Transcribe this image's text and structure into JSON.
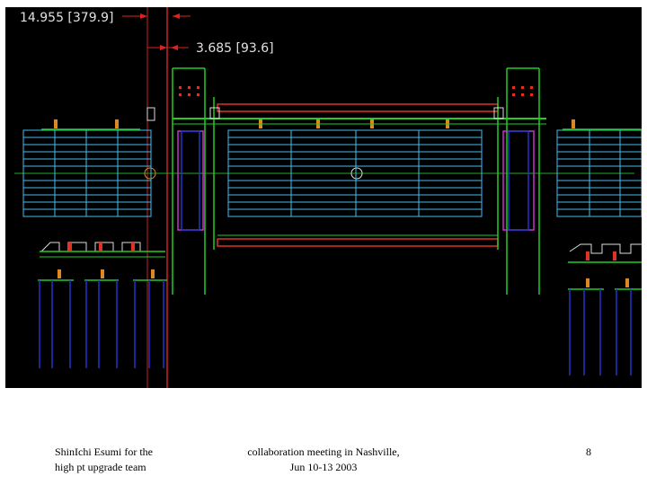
{
  "drawing": {
    "dim_outer": "14.955 [379.9]",
    "dim_inner": "3.685 [93.6]"
  },
  "footer": {
    "author_line1": "ShinIchi Esumi for the",
    "author_line2": "high pt upgrade team",
    "meeting_line1": "collaboration meeting in Nashville,",
    "meeting_line2": "Jun 10-13 2003",
    "page_number": "8"
  },
  "colors": {
    "background": "#000000",
    "frame_green": "#22cc22",
    "ladder_cyan": "#44bbee",
    "beam_red": "#dd3322",
    "support_blue": "#2233cc",
    "cap_orange": "#dd8822",
    "bracket_magenta": "#cc33cc"
  }
}
